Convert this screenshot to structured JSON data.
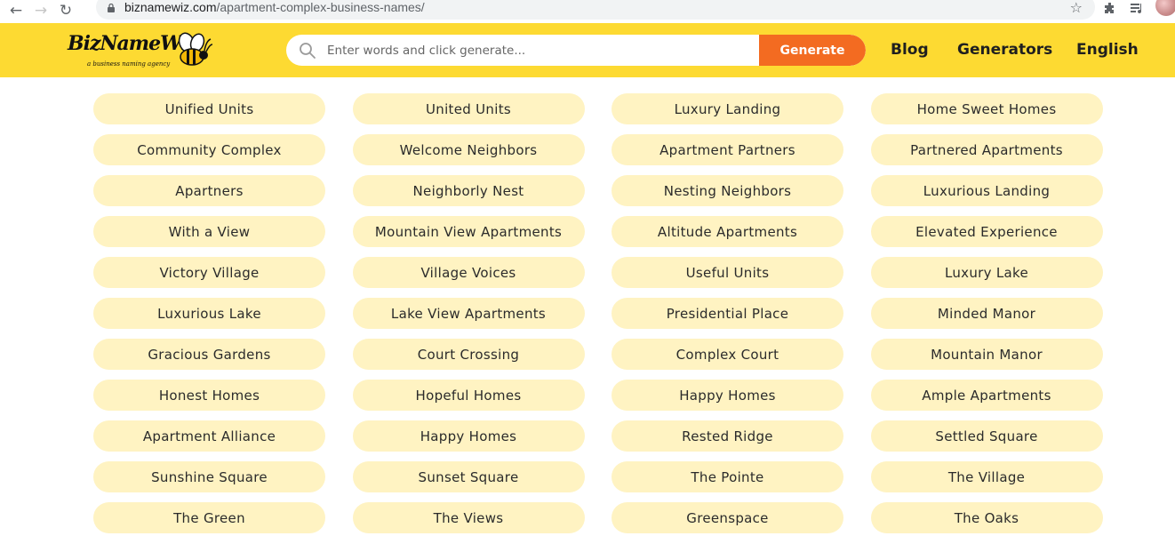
{
  "browser": {
    "url_domain": "biznamewiz.com",
    "url_path": "/apartment-complex-business-names/"
  },
  "header": {
    "logo_text": "BizNameWiz",
    "logo_tagline": "a business naming agency",
    "search_placeholder": "Enter words and click generate...",
    "generate_label": "Generate",
    "nav": {
      "blog": "Blog",
      "generators": "Generators",
      "language": "English"
    },
    "colors": {
      "header_bg": "#fdda32",
      "generate_bg": "#f36b21",
      "pill_bg": "#fff3c2"
    }
  },
  "names": [
    "Unified Units",
    "United Units",
    "Luxury Landing",
    "Home Sweet Homes",
    "Community Complex",
    "Welcome Neighbors",
    "Apartment Partners",
    "Partnered Apartments",
    "Apartners",
    "Neighborly Nest",
    "Nesting Neighbors",
    "Luxurious Landing",
    "With a View",
    "Mountain View Apartments",
    "Altitude Apartments",
    "Elevated Experience",
    "Victory Village",
    "Village Voices",
    "Useful Units",
    "Luxury Lake",
    "Luxurious Lake",
    "Lake View Apartments",
    "Presidential Place",
    "Minded Manor",
    "Gracious Gardens",
    "Court Crossing",
    "Complex Court",
    "Mountain Manor",
    "Honest Homes",
    "Hopeful Homes",
    "Happy Homes",
    "Ample Apartments",
    "Apartment Alliance",
    "Happy Homes",
    "Rested Ridge",
    "Settled Square",
    "Sunshine Square",
    "Sunset Square",
    "The Pointe",
    "The Village",
    "The Green",
    "The Views",
    "Greenspace",
    "The Oaks"
  ]
}
